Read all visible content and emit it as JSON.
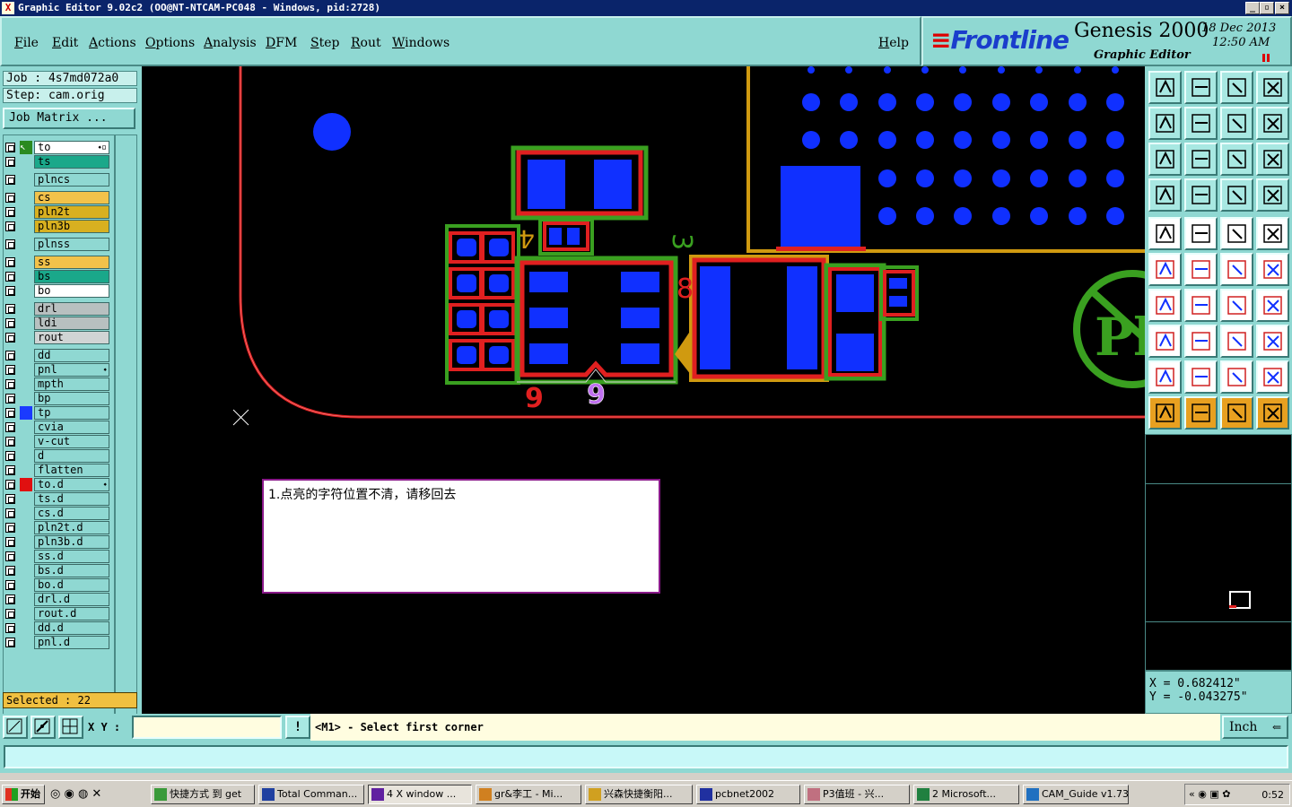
{
  "window": {
    "title": "Graphic Editor 9.02c2  (OO@NT-NTCAM-PC048 - Windows, pid:2728)"
  },
  "menu": [
    "File",
    "Edit",
    "Actions",
    "Options",
    "Analysis",
    "DFM",
    "Step",
    "Rout",
    "Windows"
  ],
  "help_label": "Help",
  "brand": {
    "logo": "Frontline",
    "product": "Genesis 2000",
    "subtitle": "Graphic Editor",
    "date": "18 Dec 2013",
    "time": "12:50  AM"
  },
  "job": {
    "job_label": "Job : 4s7md072a0",
    "step_label": "Step: cam.orig",
    "matrix_button": "Job Matrix ..."
  },
  "layers": [
    {
      "name": "to",
      "color": "#ffffff",
      "marker": "#2030ff",
      "arrow": true,
      "extra": "⬩▫"
    },
    {
      "name": "ts",
      "color": "#1aa88a"
    },
    {
      "name": "plncs",
      "color": "#8fd8d2"
    },
    {
      "name": "cs",
      "color": "#f2c24a"
    },
    {
      "name": "pln2t",
      "color": "#d8b020"
    },
    {
      "name": "pln3b",
      "color": "#d8b020"
    },
    {
      "name": "plnss",
      "color": "#8fd8d2"
    },
    {
      "name": "ss",
      "color": "#f2c24a"
    },
    {
      "name": "bs",
      "color": "#1aa88a"
    },
    {
      "name": "bo",
      "color": "#ffffff"
    },
    {
      "name": "drl",
      "color": "#b8c0c0"
    },
    {
      "name": "ldi",
      "color": "#b8c0c0"
    },
    {
      "name": "rout",
      "color": "#d0d4d4"
    },
    {
      "name": "dd",
      "color": "#8fd8d2"
    },
    {
      "name": "pnl",
      "color": "#8fd8d2",
      "extra": "⬩"
    },
    {
      "name": "mpth",
      "color": "#8fd8d2"
    },
    {
      "name": "bp",
      "color": "#8fd8d2"
    },
    {
      "name": "tp",
      "color": "#8fd8d2",
      "marker": "#1a3aff"
    },
    {
      "name": "cvia",
      "color": "#8fd8d2"
    },
    {
      "name": "v-cut",
      "color": "#8fd8d2"
    },
    {
      "name": "d",
      "color": "#8fd8d2"
    },
    {
      "name": "flatten",
      "color": "#8fd8d2"
    },
    {
      "name": "to.d",
      "color": "#8fd8d2",
      "marker": "#e01010",
      "extra": "⬩"
    },
    {
      "name": "ts.d",
      "color": "#8fd8d2"
    },
    {
      "name": "cs.d",
      "color": "#8fd8d2"
    },
    {
      "name": "pln2t.d",
      "color": "#8fd8d2"
    },
    {
      "name": "pln3b.d",
      "color": "#8fd8d2"
    },
    {
      "name": "ss.d",
      "color": "#8fd8d2"
    },
    {
      "name": "bs.d",
      "color": "#8fd8d2"
    },
    {
      "name": "bo.d",
      "color": "#8fd8d2"
    },
    {
      "name": "drl.d",
      "color": "#8fd8d2"
    },
    {
      "name": "rout.d",
      "color": "#8fd8d2"
    },
    {
      "name": "dd.d",
      "color": "#8fd8d2"
    },
    {
      "name": "pnl.d",
      "color": "#8fd8d2"
    }
  ],
  "selected": "Selected : 22",
  "canvas": {
    "silk_labels": [
      "4",
      "3",
      "8",
      "9",
      "9"
    ],
    "logo_text": "Pb"
  },
  "note": "1.点亮的字符位置不清，请移回去",
  "coords": {
    "x": "X  =  0.682412\"",
    "y": "Y  = -0.043275\""
  },
  "status": {
    "xy_label": "X Y :",
    "xy_value": "",
    "info_button": "!",
    "prompt": "<M1> - Select first corner",
    "unit": "Inch"
  },
  "taskbar": {
    "start": "开始",
    "tasks": [
      "快捷方式 到 get",
      "Total Comman...",
      "4 X window ...",
      "gr&李工 - Mi...",
      "兴森快捷衡阳...",
      "pcbnet2002",
      "P3值班 - 兴...",
      "2 Microsoft...",
      "CAM_Guide v1.73"
    ],
    "clock": "0:52"
  }
}
